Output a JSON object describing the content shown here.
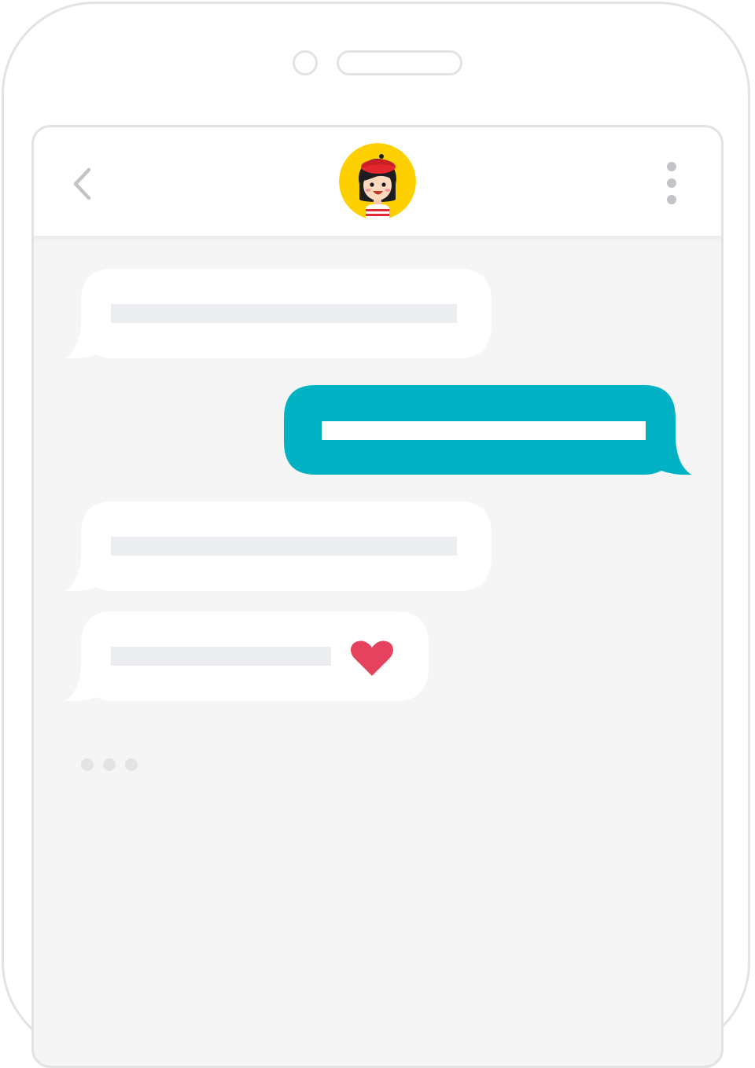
{
  "app": {
    "screen_name": "chat-conversation"
  },
  "header": {
    "back_icon": "chevron-left-icon",
    "avatar_icon": "girl-avatar-icon",
    "menu_icon": "vertical-dots-icon"
  },
  "messages": [
    {
      "direction": "incoming",
      "text": "",
      "has_heart": false
    },
    {
      "direction": "outgoing",
      "text": "",
      "has_heart": false
    },
    {
      "direction": "incoming",
      "text": "",
      "has_heart": false
    },
    {
      "direction": "incoming",
      "text": "",
      "has_heart": true
    }
  ],
  "typing_indicator": {
    "dots": 3
  },
  "colors": {
    "outgoing_bubble": "#00b2c3",
    "incoming_bubble": "#ffffff",
    "placeholder_line_incoming": "#ecedf1",
    "placeholder_line_outgoing": "#ffffff",
    "heart": "#e6425f",
    "avatar_bg": "#ffd000",
    "screen_bg": "#f5f5f5",
    "frame": "#e3e3e6"
  }
}
